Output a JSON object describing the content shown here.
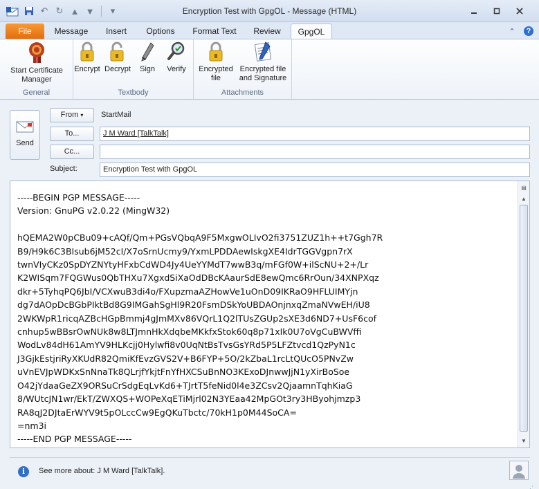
{
  "window": {
    "title": "Encryption Test with GpgOL  -  Message (HTML)",
    "controls": [
      "minimize",
      "maximize",
      "close"
    ]
  },
  "qat_icons": [
    "outlook-icon",
    "save-icon",
    "undo-icon",
    "redo-icon",
    "up-icon",
    "down-icon",
    "customize-icon"
  ],
  "tabs": [
    {
      "label": "File"
    },
    {
      "label": "Message"
    },
    {
      "label": "Insert"
    },
    {
      "label": "Options"
    },
    {
      "label": "Format Text"
    },
    {
      "label": "Review"
    },
    {
      "label": "GpgOL"
    }
  ],
  "active_tab": "GpgOL",
  "ribbon": {
    "general": {
      "label": "General",
      "start_cert_manager": "Start Certificate Manager",
      "start_cert_manager_line1": "Start Certificate",
      "start_cert_manager_line2": "Manager"
    },
    "textbody": {
      "label": "Textbody",
      "encrypt": "Encrypt",
      "decrypt": "Decrypt",
      "sign": "Sign",
      "verify": "Verify"
    },
    "attachments": {
      "label": "Attachments",
      "enc_file_line1": "Encrypted",
      "enc_file_line2": "file",
      "enc_sig_line1": "Encrypted file",
      "enc_sig_line2": "and Signature"
    }
  },
  "compose": {
    "send_label": "Send",
    "from_label": "From",
    "from_value": "StartMail",
    "to_label": "To...",
    "to_value": "J M Ward [TalkTalk]",
    "cc_label": "Cc...",
    "cc_value": "",
    "subject_label": "Subject:",
    "subject_value": "Encryption Test with GpgOL",
    "body": "-----BEGIN PGP MESSAGE-----\nVersion: GnuPG v2.0.22 (MingW32)\n\nhQEMA2W0pCBu09+cAQf/Qm+PGsVQbqA9F5MxgwOLIvO2fi3751ZUZ1h++t7Ggh7R\nB9/H9k6C3BIsub6jM52cI/X7oSrnUcmy9/YxmLPDDAewIskgXE4IdrTGGVgpn7rX\ntwnVIyCKz0SpDYZNYtyHFxbCdWD4Jy4UeYYMdT7wwB3q/mFGf0W+ilScNU+2+/Lr\nK2WISqm7FQGWus0QbTHXu7XgxdSiXaOdDBcKAaurSdE8ewQmc6RrOun/34XNPXqz\ndkr+5TyhqPQ6JbI/VCXwuB3di4o/FXupzmaAZHowVe1uOnD09IKRaO9HFLUIMYjn\ndg7dAOpDcBGbPIktBd8G9IMGahSgHl9R20FsmDSkYoUBDAOnjnxqZmaNVwEH/iU8\n2WKWpR1ricqAZBcHGpBmmj4gJmMXv86VQrL1Q2lTUsZGUp2sXE3d6ND7+UsF6cof\ncnhup5wBBsrOwNUk8w8LTJmnHkXdqbeMKkfxStok60q8p71xIk0U7oVgCuBWVffi\nWodLv84dH61AmYV9HLKcjj0Hylwfi8v0UqNtBsTvsGsYRd5P5LFZtvcd1QzPyN1c\nJ3GjkEstjriRyXKUdR82QmiKfEvzGVS2V+B6FYP+5O/2kZbaL1rcLtQUcO5PNvZw\nuVnEVJpWDKxSnNnaTk8QLrjfYkjtFnYfHXCSuBnNO3KExoDJnwwJjN1yXirBoSoe\nO42jYdaaGeZX9ORSuCrSdgEqLvKd6+TJrtT5feNid0l4e3ZCsv2QjaamnTqhKiaG\n8/WUtcJN1wr/EkT/ZWXQS+WOPeXqETiMjrl02N3YEaa42MpGOt3ry3HByohjmzp3\nRA8qJ2DJtaErWYV9t5pOLccCw9EgQKuTbctc/70kH1p0M44SoCA=\n=nm3i\n-----END PGP MESSAGE-----"
  },
  "info": {
    "text": "See more about: J M Ward [TalkTalk]."
  }
}
